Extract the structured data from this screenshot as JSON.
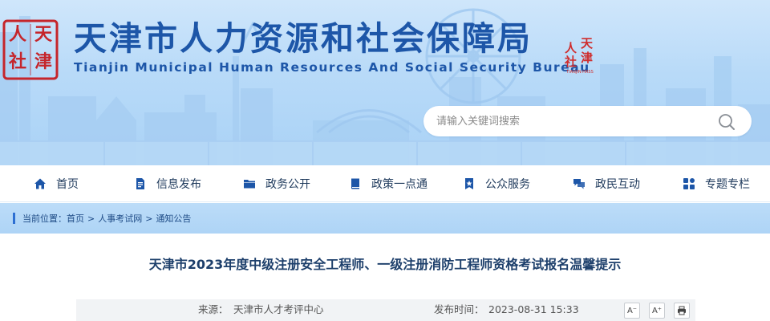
{
  "header": {
    "seal_chars": [
      "人",
      "天",
      "社",
      "津"
    ],
    "title_cn": "天津市人力资源和社会保障局",
    "title_en": "Tianjin Municipal Human Resources And Social Security Bureau",
    "stamp_chars": [
      "天",
      "津",
      "人",
      "社"
    ],
    "stamp_caption": "TIANJIN·HRSS"
  },
  "search": {
    "placeholder": "请输入关键词搜索",
    "icon": "search-icon"
  },
  "nav": {
    "items": [
      {
        "label": "首页",
        "icon": "home-icon"
      },
      {
        "label": "信息发布",
        "icon": "document-icon"
      },
      {
        "label": "政务公开",
        "icon": "folder-icon"
      },
      {
        "label": "政策一点通",
        "icon": "book-icon"
      },
      {
        "label": "公众服务",
        "icon": "bookmark-star-icon"
      },
      {
        "label": "政民互动",
        "icon": "chat-icon"
      },
      {
        "label": "专题专栏",
        "icon": "grid-icon"
      }
    ]
  },
  "breadcrumb": {
    "prefix": "当前位置：",
    "items": [
      "首页",
      "人事考试网",
      "通知公告"
    ],
    "separator": ">"
  },
  "article": {
    "title": "天津市2023年度中级注册安全工程师、一级注册消防工程师资格考试报名温馨提示",
    "source_label": "来源：",
    "source": "天津市人才考评中心",
    "date_label": "发布时间：",
    "date": "2023-08-31 15:33",
    "tools": [
      {
        "label": "A⁻",
        "icon": "font-decrease-icon"
      },
      {
        "label": "A⁺",
        "icon": "font-increase-icon"
      },
      {
        "label": "",
        "icon": "print-icon"
      }
    ]
  },
  "colors": {
    "brand_blue": "#1d56a8",
    "seal_red": "#c5252b",
    "nav_text": "#1f3a5c",
    "crumb_bg": "#aed4f6"
  }
}
